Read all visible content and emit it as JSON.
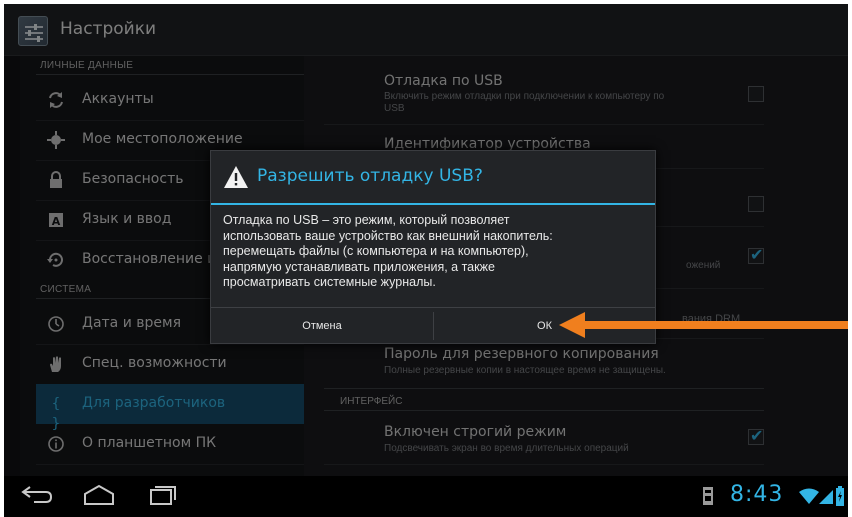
{
  "app": {
    "title": "Настройки"
  },
  "sections": {
    "personal": "ЛИЧНЫЕ ДАННЫЕ",
    "system": "СИСТЕМА",
    "interface": "ИНТЕРФЕЙС"
  },
  "nav": [
    {
      "label": "Аккаунты",
      "icon": "sync-icon"
    },
    {
      "label": "Мое местоположение",
      "icon": "location-icon"
    },
    {
      "label": "Безопасность",
      "icon": "lock-icon"
    },
    {
      "label": "Язык и ввод",
      "icon": "keyboard-icon"
    },
    {
      "label": "Восстановление и",
      "icon": "restore-icon"
    },
    {
      "label": "Дата и время",
      "icon": "clock-icon"
    },
    {
      "label": "Спец. возможности",
      "icon": "hand-icon"
    },
    {
      "label": "Для разработчиков",
      "icon": "braces-icon"
    },
    {
      "label": "О планшетном ПК",
      "icon": "info-icon"
    }
  ],
  "prefs": {
    "usb_title": "Отладка по USB",
    "usb_sub": "Включить режим отладки при подключении к компьютеру по",
    "usb_sub2": "USB",
    "device_id": "Идентификатор устройства",
    "row3_sub_partial": "ожений",
    "row4_partial": "вания DRM",
    "backup_title": "Пароль для резервного копирования",
    "backup_sub": "Полные резервные копии в настоящее время не защищены.",
    "strict_title": "Включен строгий режим",
    "strict_sub": "Подсвечивать экран во время длительных операций"
  },
  "dialog": {
    "title": "Разрешить отладку USB?",
    "message": "Отладка по USB – это режим, который позволяет\nиспользовать ваше устройство как внешний накопитель:\nперемещать файлы (с компьютера и на компьютер),\nнапрямую устанавливать приложения, а также\nпросматривать системные журналы.",
    "cancel": "Отмена",
    "ok": "ОК"
  },
  "status": {
    "time": "8:43"
  },
  "colors": {
    "accent": "#33b5e5",
    "arrow": "#f07f1e"
  }
}
